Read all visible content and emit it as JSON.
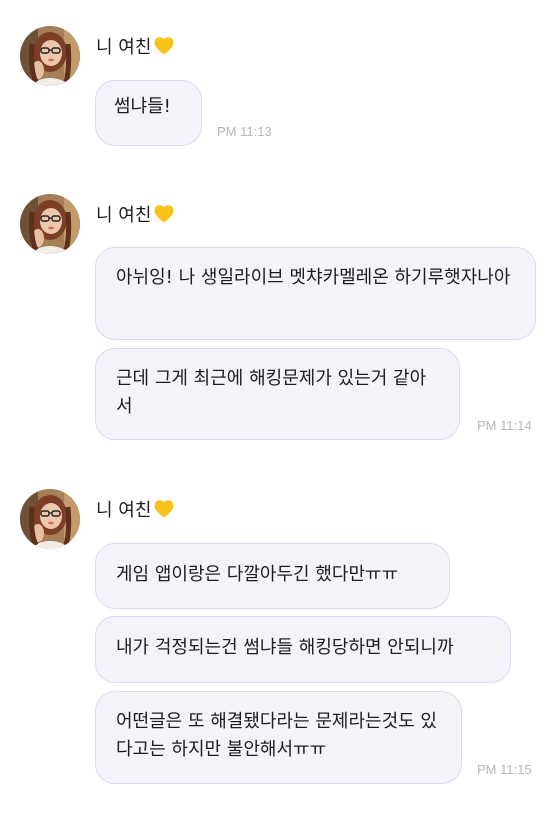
{
  "sender": {
    "name": "니 여친",
    "avatar_icon": "profile-photo-avatar",
    "heart_icon": "yellow-heart-icon",
    "heart_color": "#F7C21B"
  },
  "bubble_colors": {
    "fill": "#f3f3f9",
    "border": "#ddd9f3"
  },
  "groups": [
    {
      "messages": [
        "썸냐들!"
      ],
      "time": "PM 11:13"
    },
    {
      "messages": [
        "아뉘잉! 나 생일라이브 멧챠카멜레온 하기루햇자나아",
        "근데 그게 최근에 해킹문제가 있는거 같아서"
      ],
      "time": "PM 11:14"
    },
    {
      "messages": [
        "게임 앱이랑은 다깔아두긴 했다만ㅠㅠ",
        "내가 걱정되는건 썸냐들 해킹당하면 안되니까",
        "어떤글은 또 해결됐다라는 문제라는것도 있다고는 하지만 불안해서ㅠㅠ"
      ],
      "time": "PM 11:15"
    }
  ]
}
